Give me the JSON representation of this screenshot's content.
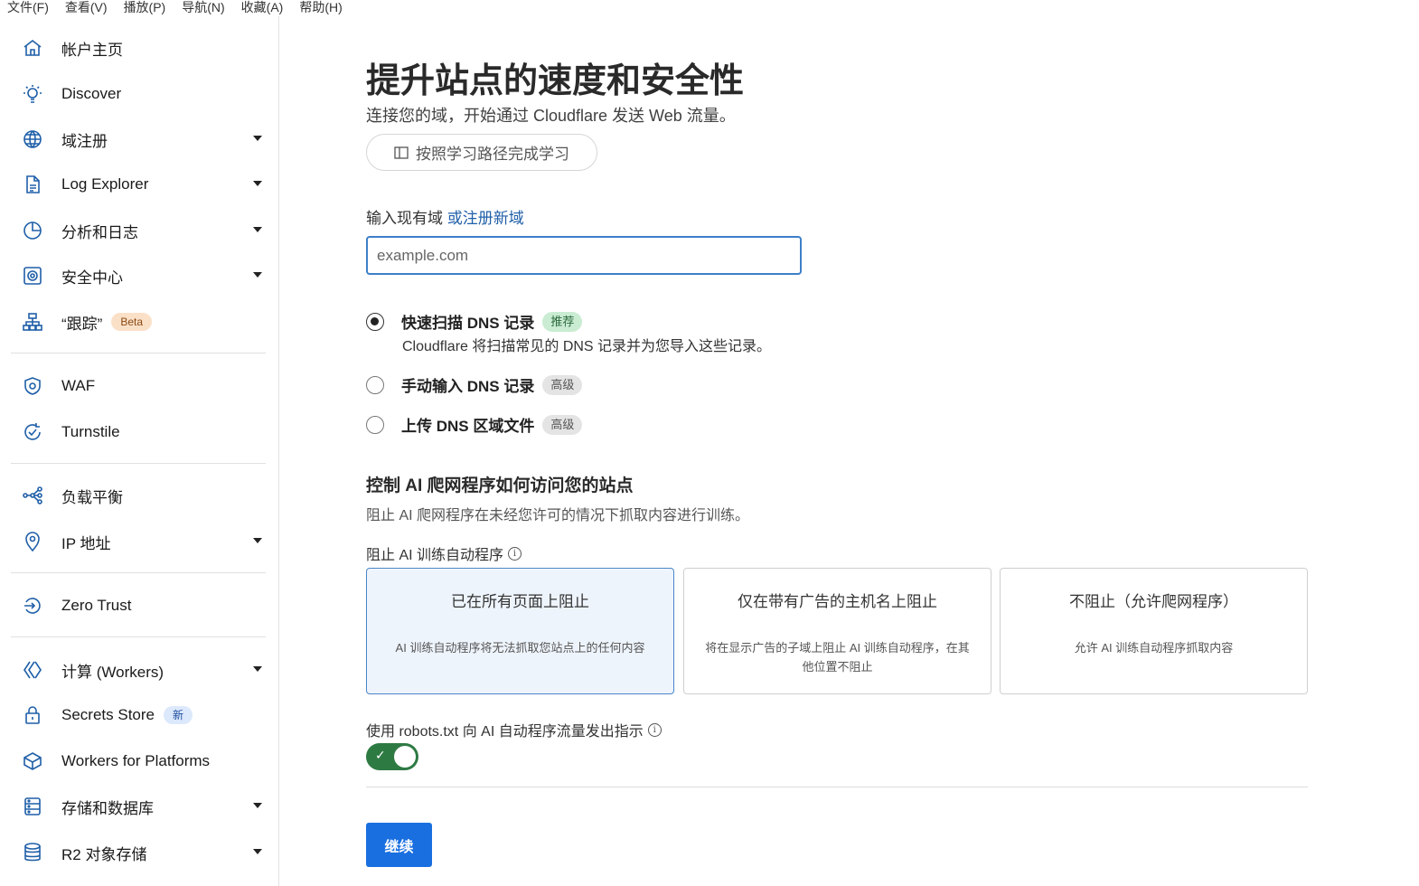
{
  "menubar": {
    "items": [
      "文件(F)",
      "查看(V)",
      "播放(P)",
      "导航(N)",
      "收藏(A)",
      "帮助(H)"
    ]
  },
  "sidebar": {
    "items": [
      {
        "label": "帐户主页",
        "icon": "home-icon",
        "caret": false
      },
      {
        "label": "Discover",
        "icon": "lightbulb-icon",
        "caret": false
      },
      {
        "label": "域注册",
        "icon": "globe-icon",
        "caret": true
      },
      {
        "label": "Log Explorer",
        "icon": "document-icon",
        "caret": true
      },
      {
        "label": "分析和日志",
        "icon": "pie-chart-icon",
        "caret": true
      },
      {
        "label": "安全中心",
        "icon": "security-center-icon",
        "caret": true
      },
      {
        "label": "“跟踪”",
        "icon": "hierarchy-icon",
        "caret": false,
        "badge": "Beta"
      },
      {
        "label": "WAF",
        "icon": "shield-icon",
        "caret": false
      },
      {
        "label": "Turnstile",
        "icon": "turnstile-icon",
        "caret": false
      },
      {
        "label": "负载平衡",
        "icon": "load-balancer-icon",
        "caret": false
      },
      {
        "label": "IP 地址",
        "icon": "location-pin-icon",
        "caret": true
      },
      {
        "label": "Zero Trust",
        "icon": "zero-trust-icon",
        "caret": false
      },
      {
        "label": "计算 (Workers)",
        "icon": "workers-icon",
        "caret": true
      },
      {
        "label": "Secrets Store",
        "icon": "lock-icon",
        "caret": false,
        "badge": "新"
      },
      {
        "label": "Workers for Platforms",
        "icon": "cube-icon",
        "caret": false
      },
      {
        "label": "存储和数据库",
        "icon": "storage-icon",
        "caret": true
      },
      {
        "label": "R2 对象存储",
        "icon": "database-icon",
        "caret": true
      }
    ]
  },
  "main": {
    "title": "提升站点的速度和安全性",
    "subtitle": "连接您的域，开始通过 Cloudflare 发送 Web 流量。",
    "learning_path_label": "按照学习路径完成学习",
    "domain_label": "输入现有域",
    "register_link": "或注册新域",
    "domain_placeholder": "example.com",
    "dns_options": [
      {
        "label": "快速扫描 DNS 记录",
        "tag": "推荐",
        "checked": true,
        "desc": "Cloudflare 将扫描常见的 DNS 记录并为您导入这些记录。"
      },
      {
        "label": "手动输入 DNS 记录",
        "tag": "高级",
        "checked": false
      },
      {
        "label": "上传 DNS 区域文件",
        "tag": "高级",
        "checked": false
      }
    ],
    "ai_title": "控制 AI 爬网程序如何访问您的站点",
    "ai_desc": "阻止 AI 爬网程序在未经您许可的情况下抓取内容进行训练。",
    "block_label": "阻止 AI 训练自动程序",
    "cards": [
      {
        "title": "已在所有页面上阻止",
        "desc": "AI 训练自动程序将无法抓取您站点上的任何内容",
        "selected": true
      },
      {
        "title": "仅在带有广告的主机名上阻止",
        "desc": "将在显示广告的子域上阻止 AI 训练自动程序，在其他位置不阻止",
        "selected": false
      },
      {
        "title": "不阻止（允许爬网程序）",
        "desc": "允许 AI 训练自动程序抓取内容",
        "selected": false
      }
    ],
    "robots_label": "使用 robots.txt 向 AI 自动程序流量发出指示",
    "robots_enabled": true,
    "continue_label": "继续"
  },
  "colors": {
    "accent": "#1a6fe0",
    "link": "#1f5fa8",
    "toggle_on": "#2e7a43",
    "selected_card_bg": "#eef4fc"
  }
}
